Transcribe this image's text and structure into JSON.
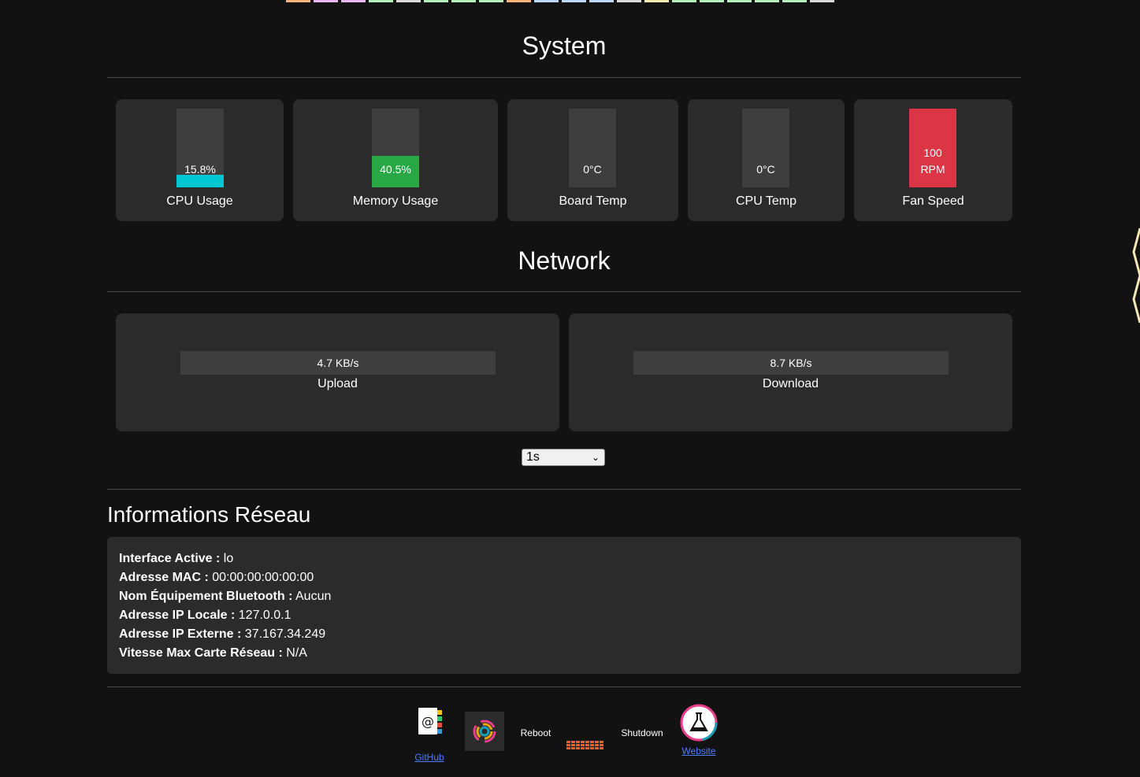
{
  "top_strip_colors": [
    "#f7b37a",
    "#eab5ef",
    "#eab5ef",
    "#b5efb9",
    "#dadada",
    "#b5efb9",
    "#b5efb9",
    "#b5efb9",
    "#f7b37a",
    "#bcd6f5",
    "#bcd6f5",
    "#bcd6f5",
    "#dadada",
    "#f5ecb3",
    "#b5efb9",
    "#b5efb9",
    "#b5efb9",
    "#b5efb9",
    "#b5efb9",
    "#dadada"
  ],
  "system": {
    "title": "System",
    "cards": [
      {
        "label": "CPU Usage",
        "value": "15.8%",
        "percent": 15.8,
        "color": "#00c8d2"
      },
      {
        "label": "Memory Usage",
        "value": "40.5%",
        "percent": 40.5,
        "color": "#28a745"
      },
      {
        "label": "Board Temp",
        "value": "0°C",
        "percent": 0,
        "color": "#28a745"
      },
      {
        "label": "CPU Temp",
        "value": "0°C",
        "percent": 0,
        "color": "#28a745"
      },
      {
        "label": "Fan Speed",
        "value_line1": "100",
        "value_line2": "RPM",
        "percent": 100,
        "color": "#dc3545"
      }
    ]
  },
  "network": {
    "title": "Network",
    "upload": {
      "label": "Upload",
      "value": "4.7 KB/s"
    },
    "download": {
      "label": "Download",
      "value": "8.7 KB/s"
    },
    "interval": {
      "selected": "1s"
    }
  },
  "info": {
    "title": "Informations Réseau",
    "rows": [
      {
        "key": "Interface Active :",
        "value": "lo"
      },
      {
        "key": "Adresse MAC :",
        "value": "00:00:00:00:00:00"
      },
      {
        "key": "Nom Équipement Bluetooth :",
        "value": "Aucun"
      },
      {
        "key": "Adresse IP Locale :",
        "value": "127.0.0.1"
      },
      {
        "key": "Adresse IP Externe :",
        "value": "37.167.34.249"
      },
      {
        "key": "Vitesse Max Carte Réseau :",
        "value": "N/A"
      }
    ]
  },
  "footer": {
    "github": "GitHub",
    "reboot": "Reboot",
    "shutdown": "Shutdown",
    "website": "Website"
  }
}
